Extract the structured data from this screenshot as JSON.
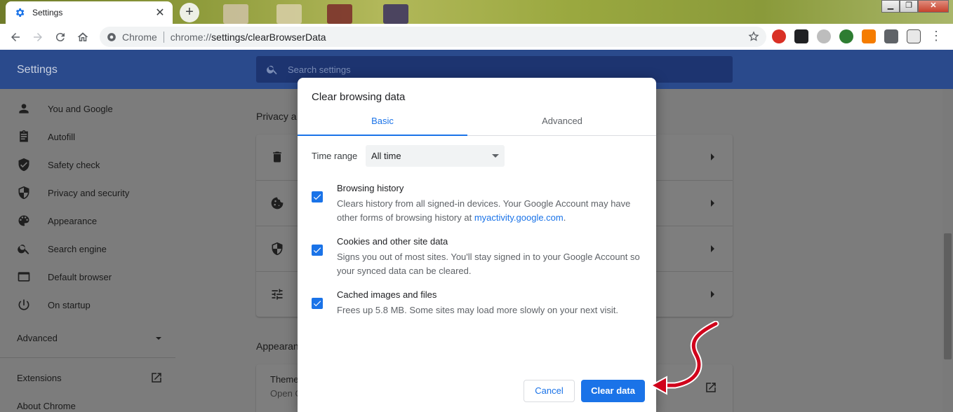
{
  "browser": {
    "tab_title": "Settings",
    "tab_close": "✕",
    "new_tab": "+",
    "omnibox_chip": "Chrome",
    "url_prefix": "chrome://",
    "url_rest": "settings/clearBrowserData"
  },
  "settings": {
    "header_title": "Settings",
    "search_placeholder": "Search settings",
    "sidebar": [
      {
        "label": "You and Google",
        "icon": "person-icon"
      },
      {
        "label": "Autofill",
        "icon": "clipboard-icon"
      },
      {
        "label": "Safety check",
        "icon": "shield-check-icon"
      },
      {
        "label": "Privacy and security",
        "icon": "shield-icon"
      },
      {
        "label": "Appearance",
        "icon": "palette-icon"
      },
      {
        "label": "Search engine",
        "icon": "search-icon"
      },
      {
        "label": "Default browser",
        "icon": "browser-icon"
      },
      {
        "label": "On startup",
        "icon": "power-icon"
      }
    ],
    "advanced_label": "Advanced",
    "extensions_label": "Extensions",
    "about_label": "About Chrome",
    "privacy_section": "Privacy a",
    "appearance_section": "Appearan",
    "theme_title": "Theme",
    "theme_sub": "Open C"
  },
  "dialog": {
    "title": "Clear browsing data",
    "tabs": [
      {
        "label": "Basic",
        "active": true
      },
      {
        "label": "Advanced",
        "active": false
      }
    ],
    "time_range_label": "Time range",
    "time_range_value": "All time",
    "options": [
      {
        "title": "Browsing history",
        "desc": "Clears history from all signed-in devices. Your Google Account may have other forms of browsing history at ",
        "link": "myactivity.google.com",
        "desc_end": ".",
        "checked": true
      },
      {
        "title": "Cookies and other site data",
        "desc": "Signs you out of most sites. You'll stay signed in to your Google Account so your synced data can be cleared.",
        "checked": true
      },
      {
        "title": "Cached images and files",
        "desc": "Frees up 5.8 MB. Some sites may load more slowly on your next visit.",
        "checked": true
      }
    ],
    "cancel_label": "Cancel",
    "clear_label": "Clear data"
  },
  "colors": {
    "accent": "#1a73e8",
    "header_blue": "#2a4a8c",
    "annotation_red": "#d0021b"
  }
}
